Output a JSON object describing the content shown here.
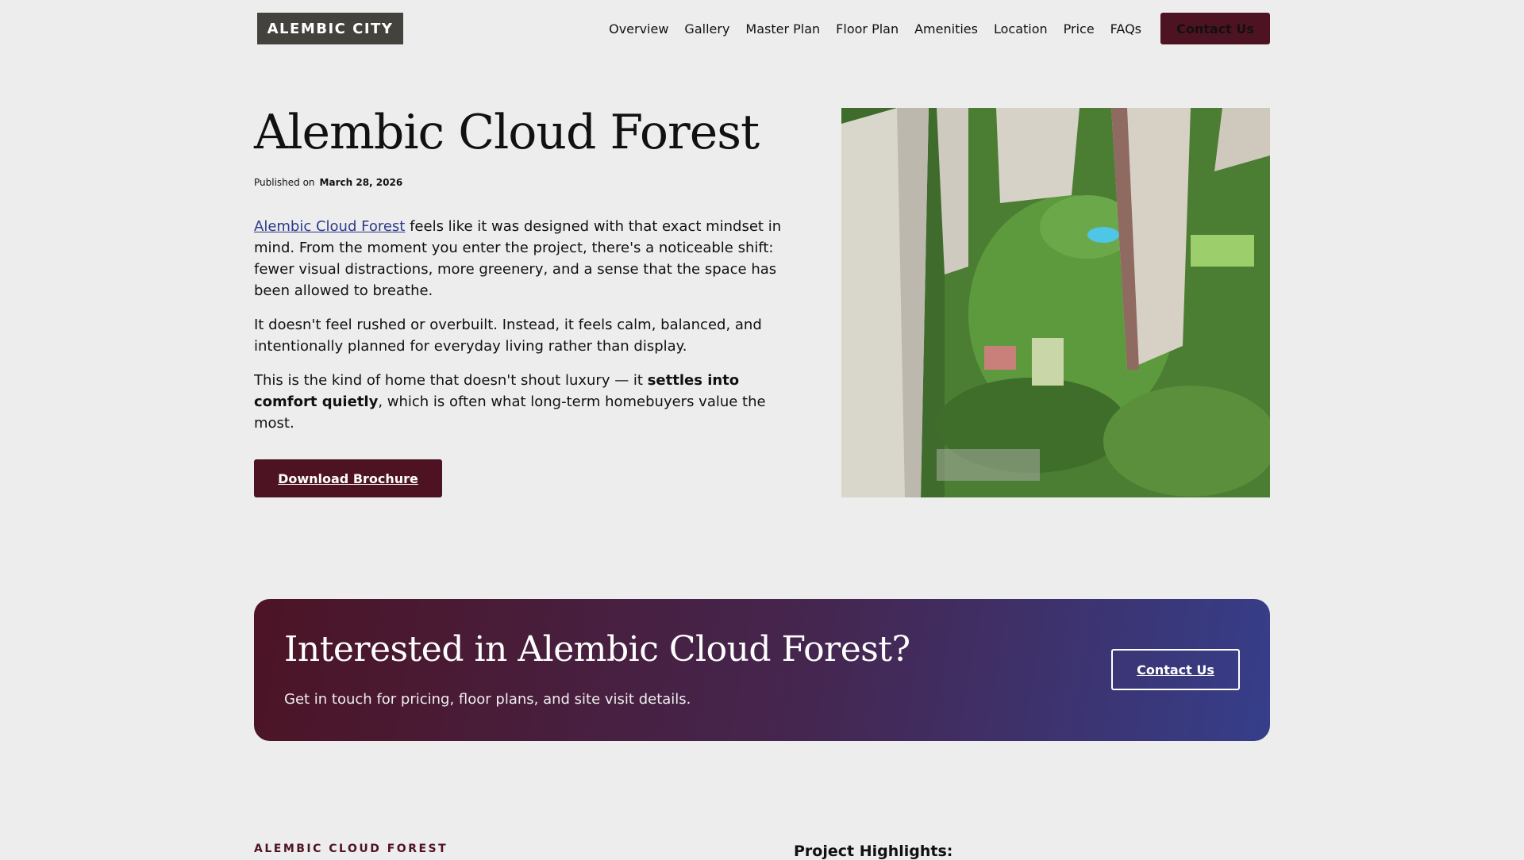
{
  "header": {
    "logo": "ALEMBIC CITY",
    "nav": [
      "Overview",
      "Gallery",
      "Master Plan",
      "Floor Plan",
      "Amenities",
      "Location",
      "Price",
      "FAQs"
    ],
    "contact": "Contact Us"
  },
  "article": {
    "title": "Alembic Cloud Forest",
    "published_label": "Published on",
    "published_date": "March 28, 2026",
    "p1_link": "Alembic Cloud Forest",
    "p1_rest": " feels like it was designed with that exact mindset in mind. From the moment you enter the project, there's a noticeable shift: fewer visual distractions, more greenery, and a sense that the space has been allowed to breathe.",
    "p2": "It doesn't feel rushed or overbuilt. Instead, it feels calm, balanced, and intentionally planned for everyday living rather than display.",
    "p3_a": "This is the kind of home that doesn't shout luxury — it ",
    "p3_b": "settles into comfort quietly",
    "p3_c": ", which is often what long-term homebuyers value the most.",
    "download": "Download Brochure"
  },
  "cta": {
    "title": "Interested in Alembic Cloud Forest?",
    "text": "Get in touch for pricing, floor plans, and site visit details.",
    "button": "Contact Us"
  },
  "footer_section": {
    "label": "ALEMBIC CLOUD FOREST",
    "highlights": "Project Highlights:"
  }
}
